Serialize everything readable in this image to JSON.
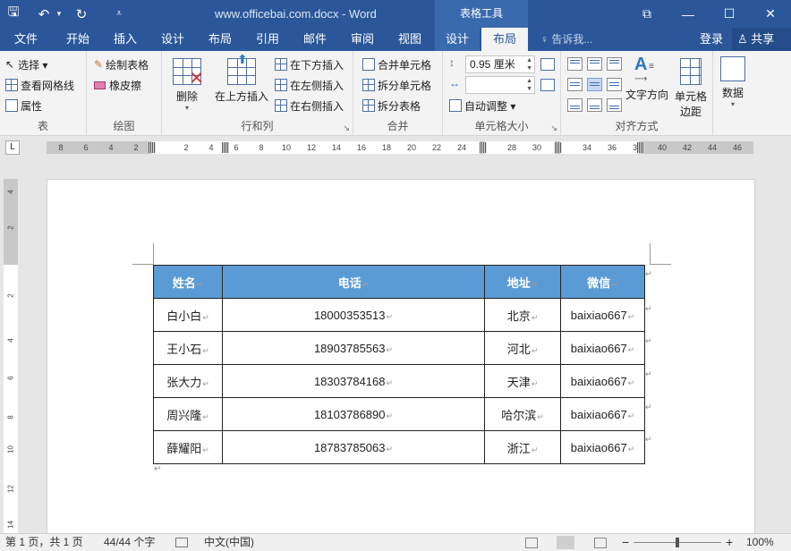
{
  "title_bar": {
    "doc_title": "www.officebai.com.docx - Word",
    "context_tab_title": "表格工具",
    "quick_access": {
      "save": "🖫",
      "undo": "↶",
      "undo_dropdown": "▾",
      "redo": "↻",
      "customize": "⩡"
    },
    "window_controls": {
      "ribbon_display": "⧉",
      "minimize": "—",
      "restore": "☐",
      "close": "✕"
    }
  },
  "tabs": [
    {
      "label": "文件"
    },
    {
      "label": "开始"
    },
    {
      "label": "插入"
    },
    {
      "label": "设计"
    },
    {
      "label": "布局"
    },
    {
      "label": "引用"
    },
    {
      "label": "邮件"
    },
    {
      "label": "审阅"
    },
    {
      "label": "视图"
    },
    {
      "label": "设计"
    },
    {
      "label": "布局"
    }
  ],
  "tellme": "♀ 告诉我...",
  "account": {
    "login": "登录",
    "share": "♙ 共享"
  },
  "ribbon": {
    "table": {
      "label": "表",
      "select": "选择 ▾",
      "view_gridlines": "查看网格线",
      "properties": "属性"
    },
    "draw": {
      "label": "绘图",
      "draw_table": "绘制表格",
      "eraser": "橡皮擦"
    },
    "rows_cols": {
      "label": "行和列",
      "delete": "删除",
      "delete_caret": "▾",
      "insert_above": "在上方插入",
      "insert_below": "在下方插入",
      "insert_left": "在左侧插入",
      "insert_right": "在右侧插入",
      "launcher": "↘"
    },
    "merge": {
      "label": "合并",
      "merge_cells": "合并单元格",
      "split_cells": "拆分单元格",
      "split_table": "拆分表格"
    },
    "cell_size": {
      "label": "单元格大小",
      "height_value": "0.95 厘米",
      "width_value": "",
      "autofit": "自动调整 ▾",
      "launcher": "↘"
    },
    "alignment": {
      "label": "对齐方式",
      "text_direction": "文字方向",
      "cell_margins_1": "单元格",
      "cell_margins_2": "边距"
    },
    "data": {
      "label": "数据",
      "caret": "▾"
    }
  },
  "ruler": {
    "tab_selector": "L",
    "h_numbers": [
      "8",
      "6",
      "4",
      "2",
      "2",
      "4",
      "6",
      "8",
      "10",
      "12",
      "14",
      "16",
      "18",
      "20",
      "22",
      "24",
      "28",
      "30",
      "34",
      "36",
      "38",
      "40",
      "42",
      "44",
      "46"
    ],
    "v_numbers": [
      "4",
      "2",
      "2",
      "4",
      "6",
      "8",
      "10",
      "12",
      "14"
    ]
  },
  "document": {
    "table": {
      "headers": [
        "姓名",
        "电话",
        "地址",
        "微信"
      ],
      "rows": [
        [
          "白小白",
          "18000353513",
          "北京",
          "baixiao667"
        ],
        [
          "王小石",
          "18903785563",
          "河北",
          "baixiao667"
        ],
        [
          "张大力",
          "18303784168",
          "天津",
          "baixiao667"
        ],
        [
          "周兴隆",
          "18103786890",
          "哈尔滨",
          "baixiao667"
        ],
        [
          "薛耀阳",
          "18783785063",
          "浙江",
          "baixiao667"
        ]
      ],
      "header_color": "#5b9bd5"
    },
    "para_mark": "↵"
  },
  "status_bar": {
    "page": "第 1 页，共 1 页",
    "words": "44/44 个字",
    "language": "中文(中国)",
    "zoom": "100%",
    "zoom_minus": "−",
    "zoom_plus": "+"
  },
  "colors": {
    "title_bar": "#2b579a",
    "context_tab": "#3a6aae",
    "ribbon": "#f3f3f3"
  }
}
